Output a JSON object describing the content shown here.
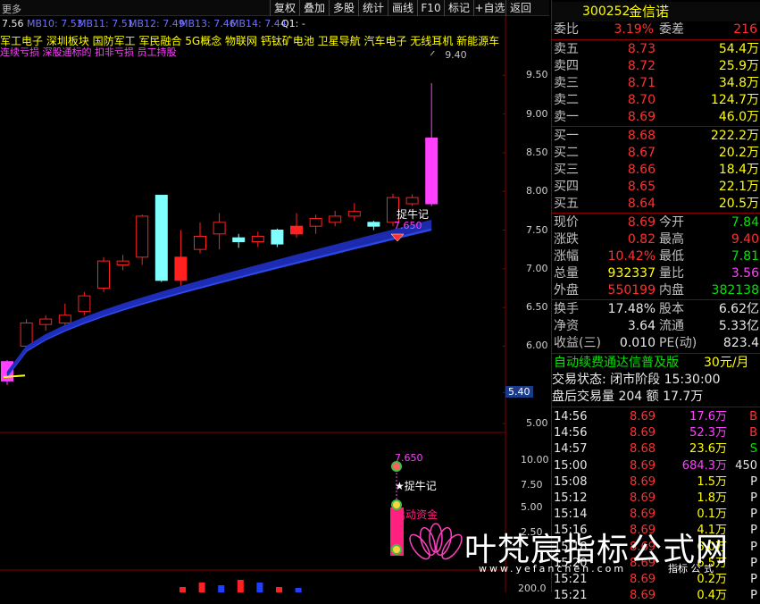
{
  "toolbar": {
    "left_label": "更多",
    "buttons": [
      "复权",
      "叠加",
      "多股",
      "统计",
      "画线",
      "F10",
      "标记",
      "+自选",
      "返回"
    ]
  },
  "ma_bar": [
    {
      "text": "7.56",
      "color": "#e8e8e8"
    },
    {
      "text": "MB10: 7.53",
      "color": "#7070ff"
    },
    {
      "text": "MB11: 7.51",
      "color": "#7070ff"
    },
    {
      "text": "MB12: 7.49",
      "color": "#7070ff"
    },
    {
      "text": "MB13: 7.46",
      "color": "#7070ff"
    },
    {
      "text": "MB14: 7.44",
      "color": "#7070ff"
    },
    {
      "text": "Q1: -",
      "color": "#e8e8e8"
    }
  ],
  "concepts": "军工电子  深圳板块  国防军工 军民融合 5G概念 物联网 钙钛矿电池 卫星导航 汽车电子 无线耳机 新能源车",
  "warning": "连续亏损 深股通标的 扣非亏损 员工持股",
  "price_axis": [
    "9.50",
    "9.00",
    "8.50",
    "8.00",
    "7.50",
    "7.00",
    "6.50",
    "6.00",
    "5.40",
    "5.00"
  ],
  "lower_axis": [
    "10.00",
    "7.50",
    "5.00",
    "2.50"
  ],
  "bottom_axis": "200.0",
  "annotations": {
    "high": "9.40",
    "signal_price": "7.650",
    "signal_name": "捉牛记",
    "lower_price": "7.650",
    "lower_signal": "★捉牛记",
    "lower_fund": "启动资金"
  },
  "quote": {
    "code": "300252",
    "name": "金信诺",
    "weibi_label": "委比",
    "weibi": "3.19%",
    "weicha_label": "委差",
    "weicha": "216",
    "asks": [
      {
        "label": "卖五",
        "price": "8.73",
        "vol": "54.4万"
      },
      {
        "label": "卖四",
        "price": "8.72",
        "vol": "25.9万"
      },
      {
        "label": "卖三",
        "price": "8.71",
        "vol": "34.8万"
      },
      {
        "label": "卖二",
        "price": "8.70",
        "vol": "124.7万"
      },
      {
        "label": "卖一",
        "price": "8.69",
        "vol": "46.0万"
      }
    ],
    "bids": [
      {
        "label": "买一",
        "price": "8.68",
        "vol": "222.2万"
      },
      {
        "label": "买二",
        "price": "8.67",
        "vol": "20.2万"
      },
      {
        "label": "买三",
        "price": "8.66",
        "vol": "18.4万"
      },
      {
        "label": "买四",
        "price": "8.65",
        "vol": "22.1万"
      },
      {
        "label": "买五",
        "price": "8.64",
        "vol": "20.5万"
      }
    ],
    "stats": [
      {
        "l1": "现价",
        "v1": "8.69",
        "l2": "今开",
        "v2": "7.84"
      },
      {
        "l1": "涨跌",
        "v1": "0.82",
        "l2": "最高",
        "v2": "9.40"
      },
      {
        "l1": "涨幅",
        "v1": "10.42%",
        "l2": "最低",
        "v2": "7.81"
      },
      {
        "l1": "总量",
        "v1": "932337",
        "l2": "量比",
        "v2": "3.56"
      },
      {
        "l1": "外盘",
        "v1": "550199",
        "l2": "内盘",
        "v2": "382138"
      }
    ],
    "fin": [
      {
        "l1": "换手",
        "v1": "17.48%",
        "l2": "股本",
        "v2": "6.62亿"
      },
      {
        "l1": "净资",
        "v1": "3.64",
        "l2": "流通",
        "v2": "5.33亿"
      },
      {
        "l1": "收益(三)",
        "v1": "0.010",
        "l2": "PE(动)",
        "v2": "823.4"
      }
    ],
    "promo": "自动续费通达信普及版",
    "promo_price": "30元/月",
    "trade_status": "交易状态: 闭市阶段 15:30:00",
    "after_hours": "盘后交易量 204 额 17.7万",
    "ticks": [
      {
        "time": "14:56",
        "price": "8.69",
        "vol": "17.6万",
        "side": "B"
      },
      {
        "time": "14:56",
        "price": "8.69",
        "vol": "52.3万",
        "side": "B"
      },
      {
        "time": "14:57",
        "price": "8.68",
        "vol": "23.6万",
        "side": "S"
      },
      {
        "time": "15:00",
        "price": "8.69",
        "vol": "684.3万",
        "side": "450"
      },
      {
        "time": "15:08",
        "price": "8.69",
        "vol": "1.5万",
        "side": "P"
      },
      {
        "time": "15:12",
        "price": "8.69",
        "vol": "1.8万",
        "side": "P"
      },
      {
        "time": "15:14",
        "price": "8.69",
        "vol": "0.1万",
        "side": "P"
      },
      {
        "time": "15:16",
        "price": "8.69",
        "vol": "4.1万",
        "side": "P"
      },
      {
        "time": "15:18",
        "price": "8.69",
        "vol": "6.0万",
        "side": "P"
      },
      {
        "time": "15:20",
        "price": "8.69",
        "vol": "6.5万",
        "side": "P"
      },
      {
        "time": "15:21",
        "price": "8.69",
        "vol": "0.2万",
        "side": "P"
      },
      {
        "time": "15:21",
        "price": "8.69",
        "vol": "0.4万",
        "side": "P"
      }
    ]
  },
  "watermark": {
    "title": "叶梵宸指标公式网",
    "url": "www.yefanchen.com",
    "tag": "指标 公 式"
  },
  "candles": [
    {
      "o": 5.8,
      "c": 5.55,
      "h": 5.82,
      "l": 5.5,
      "kind": "mag"
    },
    {
      "o": 6.0,
      "c": 6.3,
      "h": 6.35,
      "l": 5.95,
      "kind": "red"
    },
    {
      "o": 6.28,
      "c": 6.35,
      "h": 6.4,
      "l": 6.2,
      "kind": "red"
    },
    {
      "o": 6.3,
      "c": 6.4,
      "h": 6.55,
      "l": 6.25,
      "kind": "red"
    },
    {
      "o": 6.45,
      "c": 6.65,
      "h": 6.7,
      "l": 6.4,
      "kind": "red"
    },
    {
      "o": 6.75,
      "c": 7.1,
      "h": 7.15,
      "l": 6.7,
      "kind": "red"
    },
    {
      "o": 7.05,
      "c": 7.1,
      "h": 7.18,
      "l": 6.98,
      "kind": "red"
    },
    {
      "o": 7.15,
      "c": 7.68,
      "h": 7.7,
      "l": 7.05,
      "kind": "red"
    },
    {
      "o": 7.95,
      "c": 6.85,
      "h": 7.95,
      "l": 6.83,
      "kind": "cyan"
    },
    {
      "o": 7.15,
      "c": 6.85,
      "h": 7.5,
      "l": 6.78,
      "kind": "red"
    },
    {
      "o": 7.25,
      "c": 7.42,
      "h": 7.6,
      "l": 7.2,
      "kind": "red"
    },
    {
      "o": 7.45,
      "c": 7.6,
      "h": 7.72,
      "l": 7.25,
      "kind": "red"
    },
    {
      "o": 7.4,
      "c": 7.35,
      "h": 7.45,
      "l": 7.27,
      "kind": "cyan"
    },
    {
      "o": 7.35,
      "c": 7.42,
      "h": 7.48,
      "l": 7.28,
      "kind": "red"
    },
    {
      "o": 7.5,
      "c": 7.32,
      "h": 7.52,
      "l": 7.28,
      "kind": "cyan"
    },
    {
      "o": 7.55,
      "c": 7.45,
      "h": 7.72,
      "l": 7.4,
      "kind": "red"
    },
    {
      "o": 7.55,
      "c": 7.65,
      "h": 7.7,
      "l": 7.45,
      "kind": "red"
    },
    {
      "o": 7.6,
      "c": 7.68,
      "h": 7.75,
      "l": 7.55,
      "kind": "red"
    },
    {
      "o": 7.68,
      "c": 7.74,
      "h": 7.85,
      "l": 7.62,
      "kind": "red"
    },
    {
      "o": 7.6,
      "c": 7.55,
      "h": 7.62,
      "l": 7.5,
      "kind": "cyan"
    },
    {
      "o": 7.6,
      "c": 7.92,
      "h": 7.97,
      "l": 7.55,
      "kind": "red"
    },
    {
      "o": 7.84,
      "c": 7.92,
      "h": 7.96,
      "l": 7.81,
      "kind": "red"
    },
    {
      "o": 7.84,
      "c": 8.69,
      "h": 9.4,
      "l": 7.81,
      "kind": "mag"
    }
  ],
  "volumes": [
    0,
    0,
    0,
    0,
    0,
    0.3,
    0.55,
    0.4,
    0.7,
    0.55,
    0.3,
    0.25,
    0,
    0,
    0,
    0,
    0,
    0,
    0,
    0,
    0,
    0,
    0
  ],
  "volume_colors": [
    "#ff2020",
    "#2040ff",
    "#ff2020",
    "#ff2020",
    "#2040ff",
    "#ff2020",
    "#ff2020",
    "#2040ff",
    "#ff2020",
    "#2040ff",
    "#ff2020",
    "#2040ff",
    "#ff2020",
    "#2040ff",
    "#ff2020",
    "#2040ff",
    "#ff2020",
    "#ff2020",
    "#ff2020",
    "#2040ff",
    "#ff2020",
    "#ff2020",
    "#ff2020"
  ]
}
